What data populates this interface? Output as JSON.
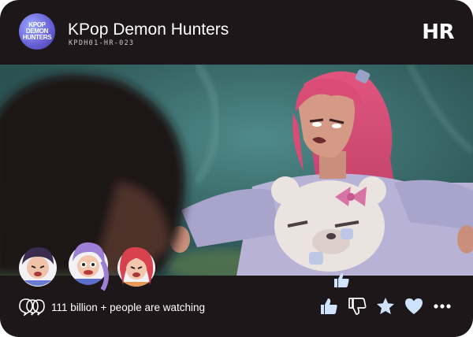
{
  "header": {
    "logo_lines": [
      "KPOP",
      "DEMON",
      "HUNTERS"
    ],
    "title": "KPop Demon Hunters",
    "code": "KPDH01-HR-023",
    "badge": "HR"
  },
  "footer": {
    "viewers_text": "111 billion + people are watching",
    "actions": [
      {
        "name": "thumbs-up-icon",
        "color": "#cfe3ff"
      },
      {
        "name": "thumbs-down-icon",
        "color": "#ffffff"
      },
      {
        "name": "star-icon",
        "color": "#cfe3ff"
      },
      {
        "name": "heart-icon",
        "color": "#cfe3ff"
      },
      {
        "name": "more-icon",
        "color": "#ffffff"
      }
    ]
  },
  "stickers": [
    "purple-hair-girl-sticker",
    "braided-girl-sticker",
    "red-hair-girl-sticker"
  ],
  "colors": {
    "card_background": "#1e1719",
    "icon_tint": "#cfe3ff",
    "scene_teal": "#3f7274"
  }
}
